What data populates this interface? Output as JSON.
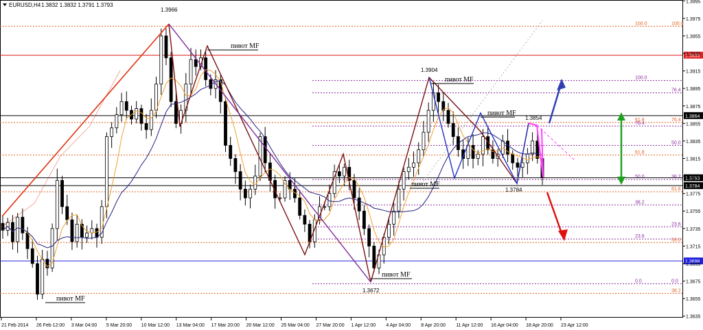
{
  "header": {
    "symbol": "EURUSD,H4",
    "ohlc": "1.3832 1.3832 1.3791 1.3793"
  },
  "colors": {
    "candle": "#000000",
    "ma_fast": "#f0a030",
    "ma_slow": "#202080",
    "zigzag_red": "#e03010",
    "zigzag_maroon": "#7a1010",
    "zigzag_purple": "#7a2a9a",
    "zigzag_blue": "#2030c0",
    "fib_orange": "#e06020",
    "fib_purple": "#8a2aa0",
    "hl_red": "#e02020",
    "hl_black": "#000000",
    "hl_blue": "#2020e0",
    "arrow_blue": "#3040b0",
    "arrow_red": "#e01010",
    "arrow_green": "#20a020",
    "magenta": "#ff40ff"
  },
  "chart_data": {
    "type": "candlestick",
    "title": "EURUSD,H4  1.3832 1.3832 1.3791 1.3793",
    "ylim": [
      1.3634,
      1.3996
    ],
    "y_ticks": [
      "1.3995",
      "1.3975",
      "1.3955",
      "1.3935",
      "1.3915",
      "1.3895",
      "1.3875",
      "1.3855",
      "1.3835",
      "1.3815",
      "1.3795",
      "1.3775",
      "1.3755",
      "1.3735",
      "1.3715",
      "1.3695",
      "1.3675",
      "1.3655",
      "1.3635"
    ],
    "x_ticks": [
      "21 Feb 2014",
      "26 Feb 12:00",
      "3 Mar 04:00",
      "5 Mar 20:00",
      "10 Mar 12:00",
      "13 Mar 04:00",
      "17 Mar 20:00",
      "20 Mar 12:00",
      "25 Mar 04:00",
      "27 Mar 20:00",
      "1 Apr 12:00",
      "4 Apr 04:00",
      "8 Apr 20:00",
      "11 Apr 12:00",
      "16 Apr 04:00",
      "18 Apr 20:00",
      "23 Apr 12:00"
    ],
    "series": [
      {
        "key": "close",
        "values": [
          1.3733,
          1.3742,
          1.372,
          1.3748,
          1.373,
          1.3712,
          1.3695,
          1.366,
          1.37,
          1.369,
          1.3735,
          1.379,
          1.376,
          1.3745,
          1.372,
          1.374,
          1.3725,
          1.373,
          1.3735,
          1.3725,
          1.376,
          1.384,
          1.385,
          1.3865,
          1.388,
          1.387,
          1.386,
          1.3872,
          1.3855,
          1.3848,
          1.387,
          1.39,
          1.3955,
          1.393,
          1.388,
          1.3855,
          1.387,
          1.39,
          1.3928,
          1.392,
          1.393,
          1.3905,
          1.3895,
          1.3905,
          1.388,
          1.383,
          1.3815,
          1.38,
          1.378,
          1.377,
          1.378,
          1.3795,
          1.384,
          1.381,
          1.379,
          1.377,
          1.377,
          1.379,
          1.378,
          1.377,
          1.375,
          1.374,
          1.372,
          1.3745,
          1.376,
          1.376,
          1.3775,
          1.38,
          1.3795,
          1.3805,
          1.379,
          1.377,
          1.3755,
          1.3735,
          1.3715,
          1.369,
          1.3705,
          1.3725,
          1.374,
          1.3755,
          1.378,
          1.38,
          1.3805,
          1.381,
          1.3825,
          1.3845,
          1.387,
          1.389,
          1.388,
          1.387,
          1.3855,
          1.384,
          1.3825,
          1.3815,
          1.383,
          1.3815,
          1.382,
          1.384,
          1.3825,
          1.3815,
          1.382,
          1.3835,
          1.382,
          1.381,
          1.3805,
          1.381,
          1.382,
          1.3835,
          1.3815,
          1.3793
        ]
      }
    ],
    "indicators": [
      "ma_fast",
      "ma_slow"
    ],
    "grid": false,
    "horizontal_levels": [
      {
        "price": 1.3933,
        "label": "1.3933",
        "color_key": "hl_red"
      },
      {
        "price": 1.3864,
        "label": "1.3864",
        "color_key": "hl_black"
      },
      {
        "price": 1.3793,
        "label": "1.3793",
        "color_key": "hl_black"
      },
      {
        "price": 1.3784,
        "label": "1.3784",
        "color_key": "hl_black"
      },
      {
        "price": 1.3698,
        "label": "1.3698",
        "color_key": "hl_blue"
      }
    ],
    "fib_levels": [
      {
        "price": 1.3966,
        "left": "100.0",
        "right": "100.0",
        "color_key": "fib_orange"
      },
      {
        "price": 1.3904,
        "left": "100.0",
        "right": "",
        "color_key": "fib_purple"
      },
      {
        "price": 1.389,
        "left": "",
        "right": "76.4",
        "color_key": "fib_purple"
      },
      {
        "price": 1.3856,
        "left": "61.8",
        "right": "76.4",
        "color_key": "fib_orange"
      },
      {
        "price": 1.3852,
        "left": "76.4",
        "right": "",
        "color_key": "fib_purple"
      },
      {
        "price": 1.383,
        "left": "",
        "right": "50.0",
        "color_key": "fib_purple"
      },
      {
        "price": 1.3819,
        "left": "61.8",
        "right": "",
        "color_key": "fib_orange"
      },
      {
        "price": 1.3791,
        "left": "50.0",
        "right": "38.2",
        "color_key": "fib_purple"
      },
      {
        "price": 1.3777,
        "left": "",
        "right": "61.8",
        "color_key": "fib_orange"
      },
      {
        "price": 1.3762,
        "left": "38.2",
        "right": "",
        "color_key": "fib_purple"
      },
      {
        "price": 1.3737,
        "left": "",
        "right": "23.6",
        "color_key": "fib_purple"
      },
      {
        "price": 1.3723,
        "left": "23.6",
        "right": "",
        "color_key": "fib_purple"
      },
      {
        "price": 1.3719,
        "left": "",
        "right": "50.0",
        "color_key": "fib_orange"
      },
      {
        "price": 1.3672,
        "left": "0.0",
        "right": "0.0",
        "color_key": "fib_purple"
      },
      {
        "price": 1.3661,
        "left": "",
        "right": "38.2",
        "color_key": "fib_orange"
      }
    ],
    "annotations": [
      {
        "id": "p1",
        "text": "1.3966",
        "type": "price"
      },
      {
        "id": "p2",
        "text": "1.3904",
        "type": "price"
      },
      {
        "id": "p3",
        "text": "1.3854",
        "type": "price"
      },
      {
        "id": "p4",
        "text": "1.3784",
        "type": "price"
      },
      {
        "id": "p5",
        "text": "1.3672",
        "type": "price"
      },
      {
        "id": "m1",
        "text": "пивот MF",
        "type": "pivot"
      },
      {
        "id": "m2",
        "text": "пивот MF",
        "type": "pivot"
      },
      {
        "id": "m3",
        "text": "пивот MF",
        "type": "pivot"
      },
      {
        "id": "m4",
        "text": "пивот MF",
        "type": "pivot"
      },
      {
        "id": "m5",
        "text": "пивот MF",
        "type": "pivot"
      },
      {
        "id": "m6",
        "text": "пивот MF",
        "type": "pivot"
      }
    ]
  }
}
